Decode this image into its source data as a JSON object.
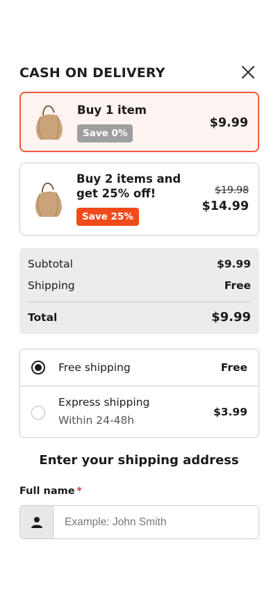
{
  "header": {
    "title": "CASH ON DELIVERY",
    "close_icon": "close-icon"
  },
  "offers": [
    {
      "title": "Buy 1 item",
      "badge": "Save 0%",
      "price": "$9.99",
      "selected": true,
      "icon": "handbag-image",
      "badge_color": "#9e9e9e"
    },
    {
      "title": "Buy 2 items and get 25% off!",
      "badge": "Save 25%",
      "compare_price": "$19.98",
      "price": "$14.99",
      "selected": false,
      "icon": "handbag-image",
      "badge_color": "#f14a1c"
    }
  ],
  "summary": {
    "subtotal_label": "Subtotal",
    "subtotal_value": "$9.99",
    "shipping_label": "Shipping",
    "shipping_value": "Free",
    "total_label": "Total",
    "total_value": "$9.99"
  },
  "shipping_options": [
    {
      "label": "Free shipping",
      "cost": "Free",
      "selected": true
    },
    {
      "label": "Express shipping",
      "sublabel": "Within 24-48h",
      "cost": "$3.99",
      "selected": false
    }
  ],
  "address": {
    "title": "Enter your shipping address",
    "full_name_label": "Full name",
    "required_marker": "*",
    "full_name_placeholder": "Example: John Smith",
    "full_name_value": "",
    "prefix_icon": "person-icon"
  },
  "colors": {
    "accent": "#ef5a3c",
    "selected_bg": "#fdf3f1",
    "summary_bg": "#ececec",
    "required": "#e53935"
  }
}
